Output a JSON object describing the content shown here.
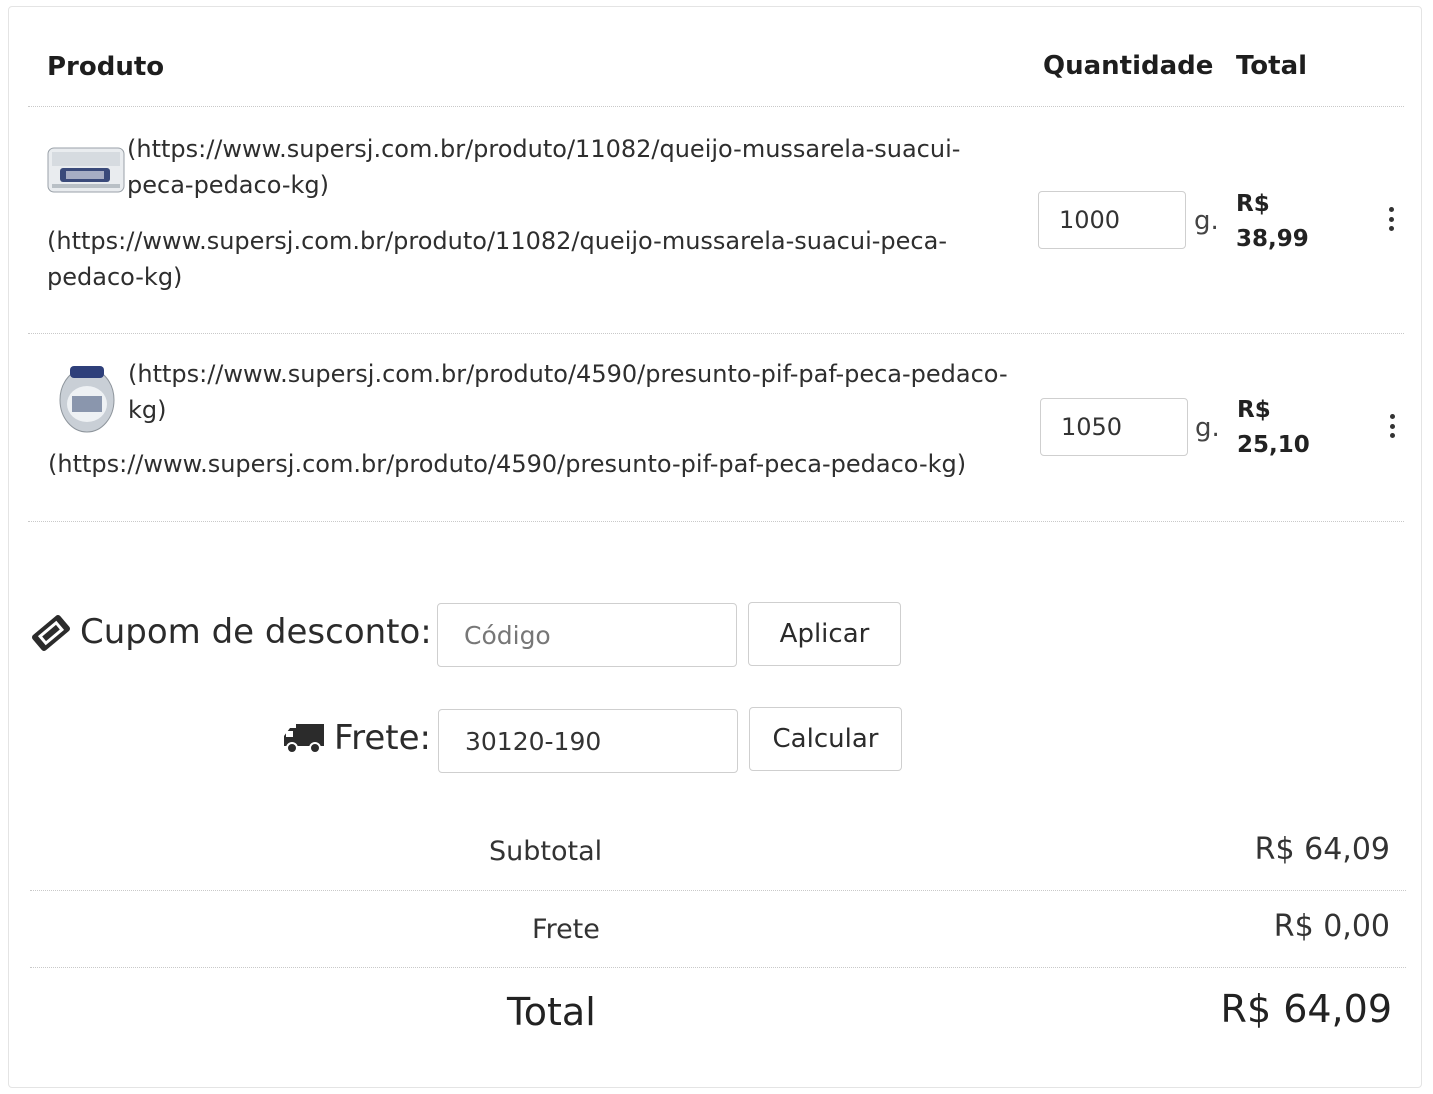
{
  "table": {
    "headers": {
      "product": "Produto",
      "quantity": "Quantidade",
      "total": "Total"
    },
    "items": [
      {
        "image_link": "(https://www.supersj.com.br/produto/11082/queijo-mussarela-suacui-peca-pedaco-kg)",
        "name_link": "(https://www.supersj.com.br/produto/11082/queijo-mussarela-suacui-peca-pedaco-kg)",
        "quantity": "1000",
        "unit": "g.",
        "currency": "R$",
        "price": "38,99"
      },
      {
        "image_link": "(https://www.supersj.com.br/produto/4590/presunto-pif-paf-peca-pedaco-kg)",
        "name_link": "(https://www.supersj.com.br/produto/4590/presunto-pif-paf-peca-pedaco-kg)",
        "quantity": "1050",
        "unit": "g.",
        "currency": "R$",
        "price": "25,10"
      }
    ]
  },
  "coupon": {
    "label": "Cupom de desconto:",
    "placeholder": "Código",
    "button": "Aplicar",
    "icon": "ticket-icon"
  },
  "shipping": {
    "label": "Frete:",
    "value": "30120-190",
    "button": "Calcular",
    "icon": "truck-icon"
  },
  "summary": {
    "subtotal_label": "Subtotal",
    "subtotal_value": "R$ 64,09",
    "shipping_label": "Frete",
    "shipping_value": "R$ 0,00",
    "total_label": "Total",
    "total_value": "R$ 64,09"
  }
}
